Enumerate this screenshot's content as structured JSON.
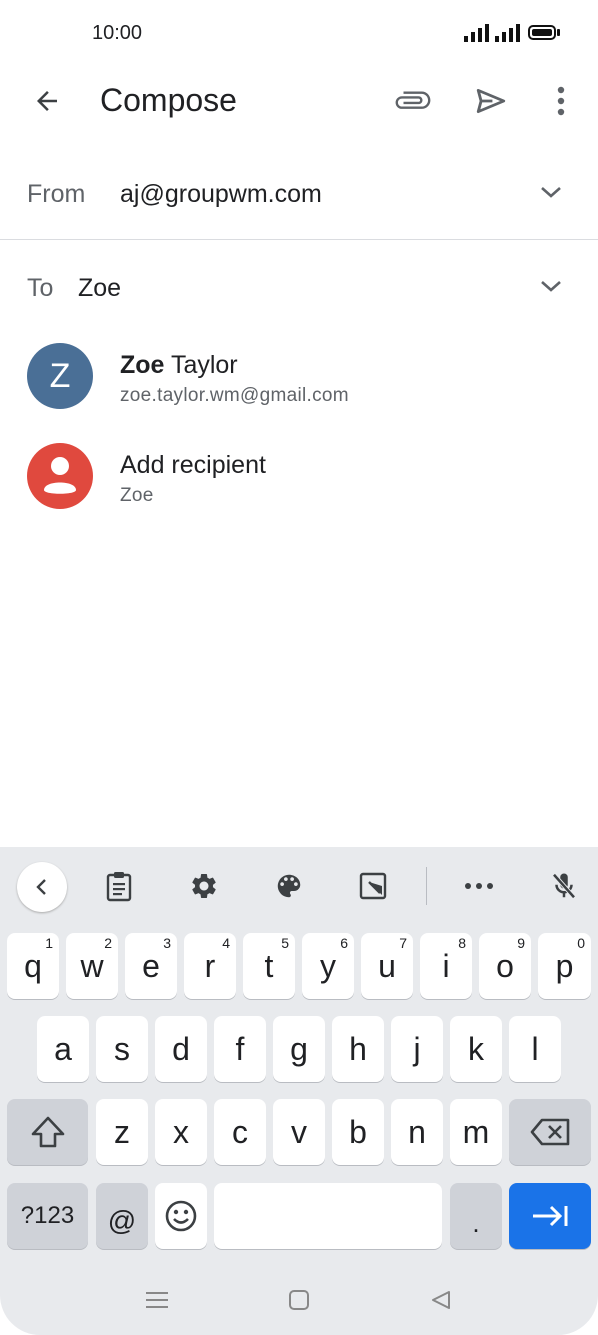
{
  "status": {
    "time": "10:00"
  },
  "appbar": {
    "title": "Compose"
  },
  "from": {
    "label": "From",
    "value": "aj@groupwm.com"
  },
  "to": {
    "label": "To",
    "value": "Zoe"
  },
  "suggestions": [
    {
      "initial": "Z",
      "name_bold": "Zoe",
      "name_rest": " Taylor",
      "sub": "zoe.taylor.wm@gmail.com",
      "color": "#4a6f96"
    },
    {
      "name": "Add recipient",
      "sub": "Zoe",
      "color": "#e0493e"
    }
  ],
  "keyboard": {
    "row1": [
      {
        "k": "q",
        "h": "1"
      },
      {
        "k": "w",
        "h": "2"
      },
      {
        "k": "e",
        "h": "3"
      },
      {
        "k": "r",
        "h": "4"
      },
      {
        "k": "t",
        "h": "5"
      },
      {
        "k": "y",
        "h": "6"
      },
      {
        "k": "u",
        "h": "7"
      },
      {
        "k": "i",
        "h": "8"
      },
      {
        "k": "o",
        "h": "9"
      },
      {
        "k": "p",
        "h": "0"
      }
    ],
    "row2": [
      "a",
      "s",
      "d",
      "f",
      "g",
      "h",
      "j",
      "k",
      "l"
    ],
    "row3": [
      "z",
      "x",
      "c",
      "v",
      "b",
      "n",
      "m"
    ],
    "symbols_label": "?123",
    "at_label": "@",
    "period_label": ".",
    "accent_color": "#1a73e8"
  }
}
